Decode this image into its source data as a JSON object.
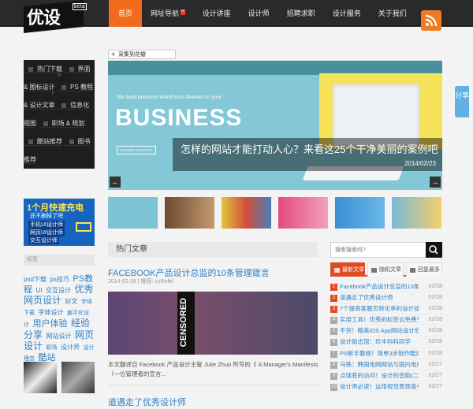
{
  "header": {
    "logo_text": "优设",
    "logo_badge": "beta",
    "nav": [
      {
        "label": "首页",
        "hot": ""
      },
      {
        "label": "网址导航",
        "hot": "H"
      },
      {
        "label": "设计讲座",
        "hot": ""
      },
      {
        "label": "设计师",
        "hot": ""
      },
      {
        "label": "招聘求职",
        "hot": ""
      },
      {
        "label": "设计服务",
        "hot": ""
      },
      {
        "label": "关于我们",
        "hot": ""
      }
    ],
    "rss_icon": "rss-icon"
  },
  "sidebar": {
    "menu": [
      {
        "label": "热门下载"
      },
      {
        "label": "界面 & 图标设计"
      },
      {
        "label": "PS 教程 & 设计文章"
      },
      {
        "label": "信息化视图"
      },
      {
        "label": "职场 & 规划"
      },
      {
        "label": "酷站推荐"
      },
      {
        "label": "图书推荐"
      }
    ],
    "ad": {
      "headline": "1个月快速充电",
      "sub": "还不删掉了吧",
      "lines": [
        "手机UI设计师",
        "网页UI设计师",
        "交互设计师"
      ]
    },
    "tags_title": "标签",
    "tags": [
      {
        "text": "psd下载",
        "size": 8
      },
      {
        "text": "ps技巧",
        "size": 8
      },
      {
        "text": "PS教程",
        "size": 11
      },
      {
        "text": "UI",
        "size": 8
      },
      {
        "text": "交互设计",
        "size": 8
      },
      {
        "text": "优秀网页设计",
        "size": 12
      },
      {
        "text": "好文",
        "size": 8
      },
      {
        "text": "字体下载",
        "size": 7
      },
      {
        "text": "字体设计",
        "size": 8
      },
      {
        "text": "扁平化设计",
        "size": 7
      },
      {
        "text": "用户体验",
        "size": 11
      },
      {
        "text": "经验分享",
        "size": 12
      },
      {
        "text": "网站设计",
        "size": 8
      },
      {
        "text": "网页设计",
        "size": 12
      },
      {
        "text": "职场",
        "size": 7
      },
      {
        "text": "设计师",
        "size": 8
      },
      {
        "text": "设计理念",
        "size": 7
      },
      {
        "text": "酷站",
        "size": 11
      }
    ]
  },
  "main": {
    "collect_label": "采集到花瓣",
    "slider": {
      "small_text": "We build premium WordPress themes for your",
      "big_text": "BUSINESS",
      "button_text": "BROWSE CATEGORY",
      "caption": "怎样的网站才能打动人心？来看这25个干净美丽的案例吧",
      "date": "2014/02/23",
      "prev": "←",
      "next": "→"
    },
    "hot_title": "热门文章",
    "articles": [
      {
        "title": "FACEBOOK产品设计总监的10条管理箴言",
        "meta": "2014-02-28 | 推荐: cyRofel",
        "image_text": "CENSORED",
        "excerpt": "本文翻译自 Facebook 产品设计主管 Julie Zhuo 所写的《 A Manager's Manifesto（一位管理者的宣言..."
      },
      {
        "title": "道遇走了优秀设计师"
      }
    ]
  },
  "right": {
    "search_placeholder": "搜索搜索吗?",
    "tabs": [
      "最新文章",
      "随机文章",
      "回复最多"
    ],
    "list": [
      {
        "text": "Facebook产品设计总监的10条",
        "date": "02/28"
      },
      {
        "text": "道遇走了优秀设计师",
        "date": "02/28"
      },
      {
        "text": "7个提高客服页转化率的设计技",
        "date": "02/28"
      },
      {
        "text": "实用工具！优秀的标签云免费生",
        "date": "02/28"
      },
      {
        "text": "干货！精美iOS App网站设计欣赏",
        "date": "02/28"
      },
      {
        "text": "设计励志馆：珍丰科科同学",
        "date": "02/28"
      },
      {
        "text": "PS新手教程！简单3步制作酷炫",
        "date": "02/28"
      },
      {
        "text": "马铁：韩国电网网站与国内电商",
        "date": "02/27"
      },
      {
        "text": "点球底的访问！设计的音韵(二)",
        "date": "02/27"
      },
      {
        "text": "设计师必读！运用视觉表现吸引",
        "date": "02/27"
      }
    ]
  },
  "share_label": "分享"
}
